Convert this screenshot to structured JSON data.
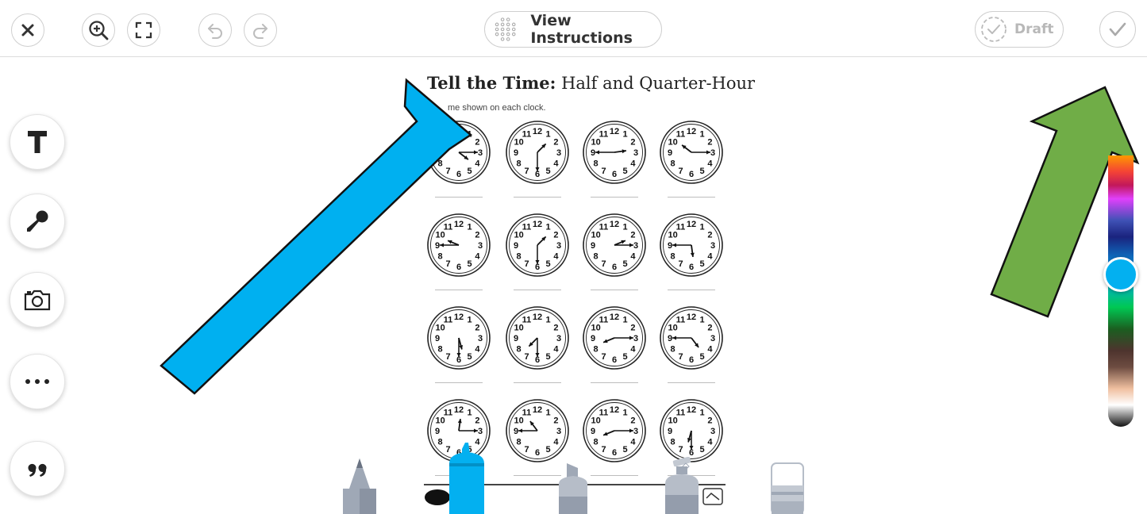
{
  "toolbar": {
    "view_instructions_label": "View Instructions",
    "draft_label": "Draft"
  },
  "worksheet": {
    "title_bold": "Tell the Time:",
    "title_rest": " Half and Quarter-Hour",
    "subtitle": "me shown on each clock.",
    "clock_numbers": [
      "12",
      "1",
      "2",
      "3",
      "4",
      "5",
      "6",
      "7",
      "8",
      "9",
      "10",
      "11"
    ],
    "clocks": [
      {
        "hour": 4,
        "minute": 15
      },
      {
        "hour": 1,
        "minute": 30
      },
      {
        "hour": 2,
        "minute": 45
      },
      {
        "hour": 10,
        "minute": 15
      },
      {
        "hour": 9,
        "minute": 45
      },
      {
        "hour": 1,
        "minute": 30
      },
      {
        "hour": 2,
        "minute": 15
      },
      {
        "hour": 5,
        "minute": 45
      },
      {
        "hour": 5,
        "minute": 30
      },
      {
        "hour": 7,
        "minute": 30
      },
      {
        "hour": 8,
        "minute": 15
      },
      {
        "hour": 4,
        "minute": 45
      },
      {
        "hour": 12,
        "minute": 15
      },
      {
        "hour": 10,
        "minute": 45
      },
      {
        "hour": 8,
        "minute": 15
      },
      {
        "hour": 6,
        "minute": 30
      }
    ]
  },
  "palette": {
    "selected_color": "#03b0f0",
    "selected_position": 0.44
  },
  "tools": {
    "active": "marker",
    "active_color": "#03b0f0"
  },
  "colors": {
    "blue_arrow": "#00b0f0",
    "green_arrow": "#70ad47"
  }
}
